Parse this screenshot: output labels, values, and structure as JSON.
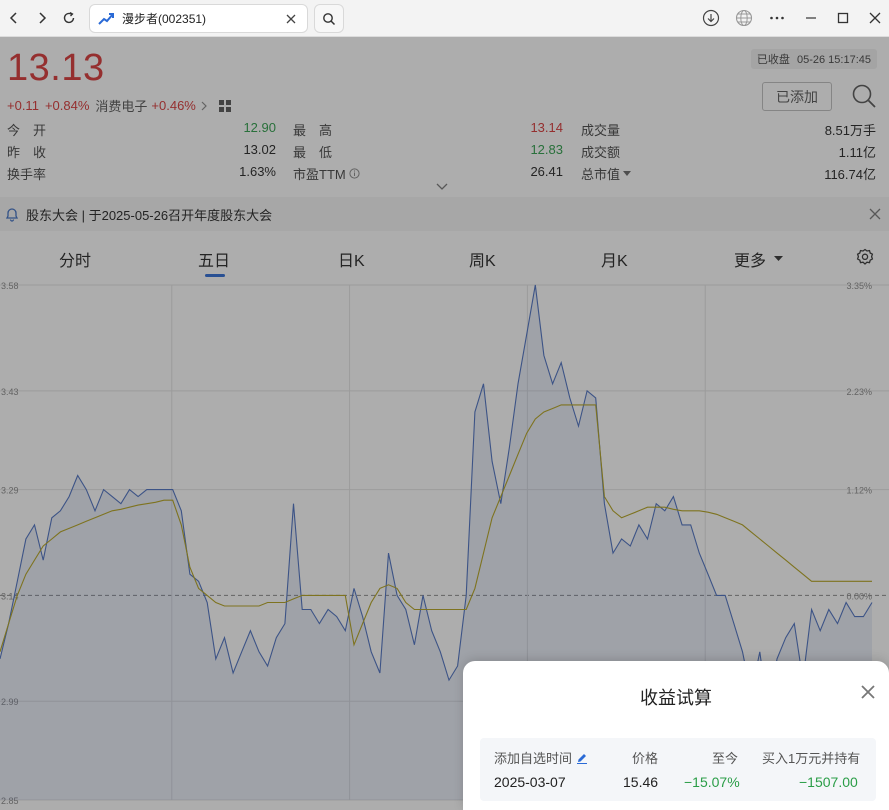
{
  "browser": {
    "tab_title": "漫步者(002351)"
  },
  "quote": {
    "price": "13.13",
    "change": "+0.11",
    "change_pct": "+0.84%",
    "sector_name": "消费电子",
    "sector_pct": "+0.46%",
    "status": "已收盘",
    "timestamp": "05-26 15:17:45",
    "added_label": "已添加"
  },
  "stats": {
    "open_label": "今　开",
    "open": "12.90",
    "prev_label": "昨　收",
    "prev": "13.02",
    "turnover_label": "换手率",
    "turnover": "1.63%",
    "high_label": "最　高",
    "high": "13.14",
    "low_label": "最　低",
    "low": "12.83",
    "pe_label": "市盈TTM",
    "pe": "26.41",
    "volume_label": "成交量",
    "volume": "8.51万手",
    "amount_label": "成交额",
    "amount": "1.11亿",
    "mktcap_label": "总市值",
    "mktcap": "116.74亿"
  },
  "notice": {
    "text": "股东大会 | 于2025-05-26召开年度股东大会"
  },
  "period_tabs": [
    {
      "label": "分时"
    },
    {
      "label": "五日"
    },
    {
      "label": "日K"
    },
    {
      "label": "周K"
    },
    {
      "label": "月K"
    },
    {
      "label": "更多"
    }
  ],
  "chart_data": {
    "type": "line",
    "y_left_ticks": [
      "3.58",
      "3.43",
      "3.29",
      "3.14",
      "2.99",
      "2.85"
    ],
    "y_right_ticks": [
      "3.35%",
      "2.23%",
      "1.12%",
      "0.00%"
    ],
    "ylim": [
      2.85,
      3.58
    ],
    "baseline": 3.14,
    "series": [
      {
        "color": "#4a6fc0",
        "values": [
          3.05,
          3.1,
          3.16,
          3.22,
          3.24,
          3.19,
          3.25,
          3.26,
          3.28,
          3.31,
          3.29,
          3.26,
          3.29,
          3.28,
          3.27,
          3.29,
          3.28,
          3.29,
          3.29,
          3.29,
          3.29,
          3.26,
          3.17,
          3.16,
          3.13,
          3.05,
          3.08,
          3.03,
          3.06,
          3.09,
          3.06,
          3.04,
          3.08,
          3.1,
          3.27,
          3.12,
          3.12,
          3.1,
          3.12,
          3.11,
          3.09,
          3.15,
          3.11,
          3.06,
          3.03,
          3.2,
          3.14,
          3.12,
          3.07,
          3.14,
          3.09,
          3.06,
          3.02,
          3.04,
          3.14,
          3.4,
          3.44,
          3.33,
          3.27,
          3.35,
          3.44,
          3.51,
          3.58,
          3.48,
          3.44,
          3.47,
          3.42,
          3.38,
          3.43,
          3.42,
          3.27,
          3.2,
          3.22,
          3.21,
          3.24,
          3.22,
          3.27,
          3.26,
          3.28,
          3.24,
          3.24,
          3.2,
          3.17,
          3.14,
          3.14,
          3.1,
          3.06,
          3.0,
          3.06,
          2.97,
          3.05,
          3.08,
          3.1,
          3.02,
          3.12,
          3.09,
          3.12,
          3.1,
          3.13,
          3.11,
          3.11,
          3.13
        ]
      },
      {
        "color": "#b3a21a",
        "values": [
          3.06,
          3.1,
          3.14,
          3.17,
          3.19,
          3.21,
          3.22,
          3.23,
          3.235,
          3.24,
          3.245,
          3.25,
          3.255,
          3.26,
          3.262,
          3.265,
          3.268,
          3.27,
          3.272,
          3.275,
          3.275,
          3.24,
          3.18,
          3.15,
          3.14,
          3.13,
          3.125,
          3.125,
          3.125,
          3.125,
          3.125,
          3.13,
          3.13,
          3.13,
          3.135,
          3.14,
          3.14,
          3.14,
          3.14,
          3.14,
          3.14,
          3.07,
          3.1,
          3.13,
          3.15,
          3.155,
          3.15,
          3.13,
          3.12,
          3.12,
          3.12,
          3.12,
          3.12,
          3.12,
          3.12,
          3.15,
          3.2,
          3.25,
          3.28,
          3.31,
          3.34,
          3.37,
          3.39,
          3.4,
          3.405,
          3.41,
          3.41,
          3.41,
          3.41,
          3.41,
          3.28,
          3.26,
          3.25,
          3.255,
          3.26,
          3.265,
          3.265,
          3.265,
          3.262,
          3.26,
          3.26,
          3.26,
          3.258,
          3.255,
          3.25,
          3.245,
          3.24,
          3.23,
          3.22,
          3.21,
          3.2,
          3.19,
          3.18,
          3.17,
          3.16,
          3.16,
          3.16,
          3.16,
          3.16,
          3.16,
          3.16,
          3.16
        ]
      }
    ]
  },
  "dialog": {
    "title": "收益试算",
    "col_time": "添加自选时间",
    "col_price": "价格",
    "col_since": "至今",
    "col_hold": "买入1万元并持有",
    "date": "2025-03-07",
    "price": "15.46",
    "since": "−15.07%",
    "hold": "−1507.00"
  },
  "colors": {
    "up": "#d83535",
    "down": "#2a9d47",
    "accent": "#2a6ad6"
  }
}
